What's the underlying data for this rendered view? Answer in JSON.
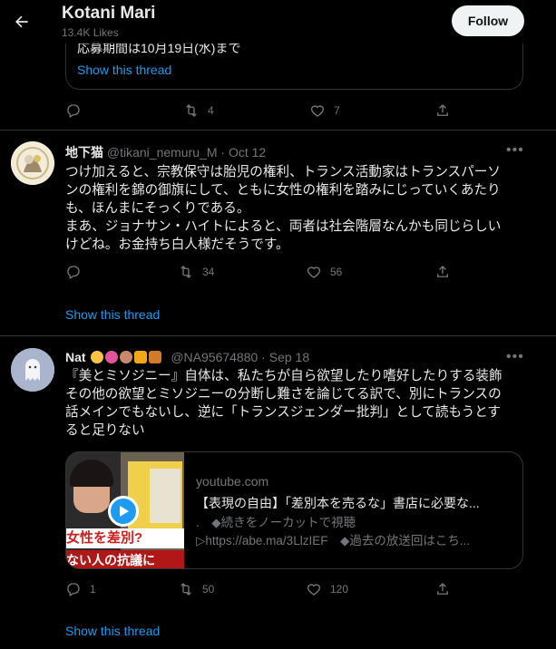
{
  "header": {
    "title": "Kotani Mari",
    "subtitle": "13.4K Likes",
    "follow_label": "Follow"
  },
  "quoted": {
    "text": "応募期間は10月19日(水)まで",
    "show_thread": "Show this thread",
    "actions": {
      "retweets": "4",
      "likes": "7"
    }
  },
  "tweets": [
    {
      "name": "地下猫",
      "handle": "@tikani_nemuru_M",
      "date": "Oct 12",
      "lines": [
        "つけ加えると、宗教保守は胎児の権利、トランス活動家はトランスパーソ",
        "ンの権利を錦の御旗にして、ともに女性の権利を踏みにじっていくあたり",
        "も、ほんまにそっくりである。",
        "まあ、ジョナサン・ハイトによると、両者は社会階層なんかも同じらしい",
        "けどね。お金持ち白人様だそうです。"
      ],
      "actions": {
        "replies": "",
        "retweets": "34",
        "likes": "56"
      },
      "show_thread": "Show this thread"
    },
    {
      "name": "Nat",
      "handle": "@NA95674880",
      "date": "Sep 18",
      "lines": [
        "『美とミソジニー』自体は、私たちが自ら欲望したり嗜好したりする装飾",
        "その他の欲望とミソジニーの分断し難さを論じてる訳で、別にトランスの",
        "話メインでもないし、逆に「トランスジェンダー批判」として読もうとす",
        "ると足りない"
      ],
      "card": {
        "domain": "youtube.com",
        "title": "【表現の自由】「差別本を売るな」書店に必要な...",
        "desc_line1": ".　◆続きをノーカットで視聴",
        "desc_line2": "▷https://abe.ma/3LlzIEF　◆過去の放送回はこち...",
        "thumb_text1": "女性を差別?",
        "thumb_text2": "ない人の抗議に"
      },
      "actions": {
        "replies": "1",
        "retweets": "50",
        "likes": "120"
      },
      "show_thread": "Show this thread"
    }
  ],
  "colors": {
    "background": "#000000",
    "accent": "#1d9bf0",
    "muted": "#71767b",
    "divider": "#2f3336"
  },
  "icons": [
    "back-arrow-icon",
    "reply-icon",
    "retweet-icon",
    "like-icon",
    "share-icon",
    "more-icon",
    "play-icon"
  ]
}
